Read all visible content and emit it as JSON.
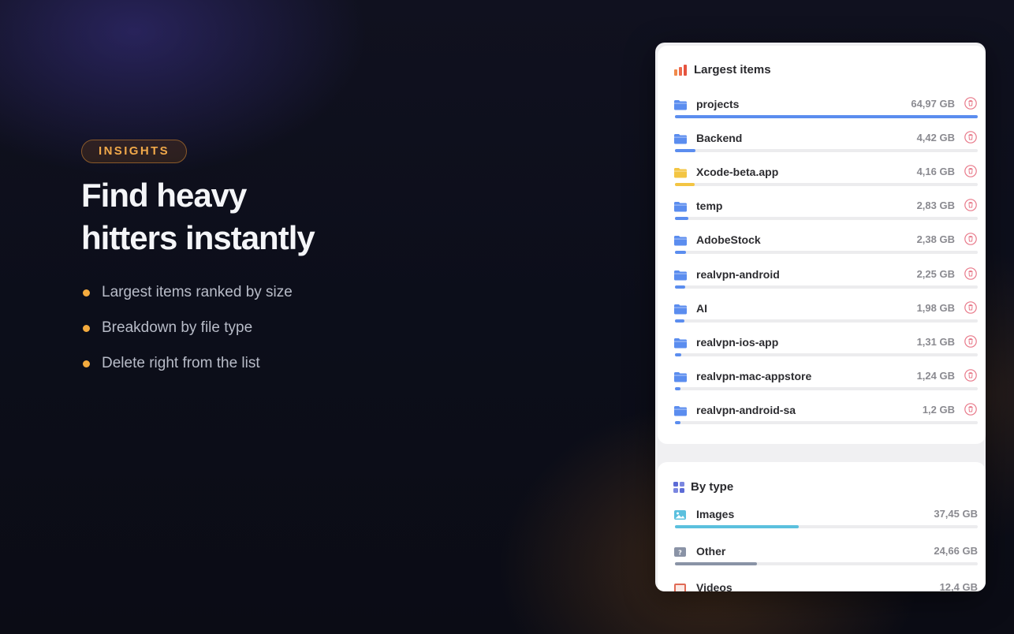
{
  "hero": {
    "badge": "INSIGHTS",
    "headline_line1": "Find heavy",
    "headline_line2": "hitters instantly",
    "bullets": [
      "Largest items ranked by size",
      "Breakdown by file type",
      "Delete right from the list"
    ]
  },
  "largest": {
    "title": "Largest items",
    "icon": "bar-chart-icon",
    "items": [
      {
        "name": "projects",
        "size": "64,97 GB",
        "fraction": 1.0,
        "icon": "folder-icon",
        "color": "#5b8def"
      },
      {
        "name": "Backend",
        "size": "4,42 GB",
        "fraction": 0.068,
        "icon": "folder-icon",
        "color": "#5b8def"
      },
      {
        "name": "Xcode-beta.app",
        "size": "4,16 GB",
        "fraction": 0.064,
        "icon": "app-folder-icon",
        "color": "#f3c543"
      },
      {
        "name": "temp",
        "size": "2,83 GB",
        "fraction": 0.044,
        "icon": "folder-icon",
        "color": "#5b8def"
      },
      {
        "name": "AdobeStock",
        "size": "2,38 GB",
        "fraction": 0.037,
        "icon": "folder-icon",
        "color": "#5b8def"
      },
      {
        "name": "realvpn-android",
        "size": "2,25 GB",
        "fraction": 0.035,
        "icon": "folder-icon",
        "color": "#5b8def"
      },
      {
        "name": "AI",
        "size": "1,98 GB",
        "fraction": 0.03,
        "icon": "folder-icon",
        "color": "#5b8def"
      },
      {
        "name": "realvpn-ios-app",
        "size": "1,31 GB",
        "fraction": 0.02,
        "icon": "folder-icon",
        "color": "#5b8def"
      },
      {
        "name": "realvpn-mac-appstore",
        "size": "1,24 GB",
        "fraction": 0.019,
        "icon": "folder-icon",
        "color": "#5b8def"
      },
      {
        "name": "realvpn-android-sa",
        "size": "1,2 GB",
        "fraction": 0.018,
        "icon": "folder-icon",
        "color": "#5b8def"
      }
    ]
  },
  "by_type": {
    "title": "By type",
    "icon": "grid-icon",
    "items": [
      {
        "name": "Images",
        "size": "37,45 GB",
        "fraction": 0.41,
        "icon": "image-icon",
        "color": "#5bc0de"
      },
      {
        "name": "Other",
        "size": "24,66 GB",
        "fraction": 0.27,
        "icon": "other-file-icon",
        "color": "#8a93a6"
      },
      {
        "name": "Videos",
        "size": "12,4 GB",
        "fraction": 0.135,
        "icon": "video-icon",
        "color": "#e06a55"
      }
    ]
  },
  "colors": {
    "accent": "#f4ab3e",
    "trash": "#e8798a"
  }
}
